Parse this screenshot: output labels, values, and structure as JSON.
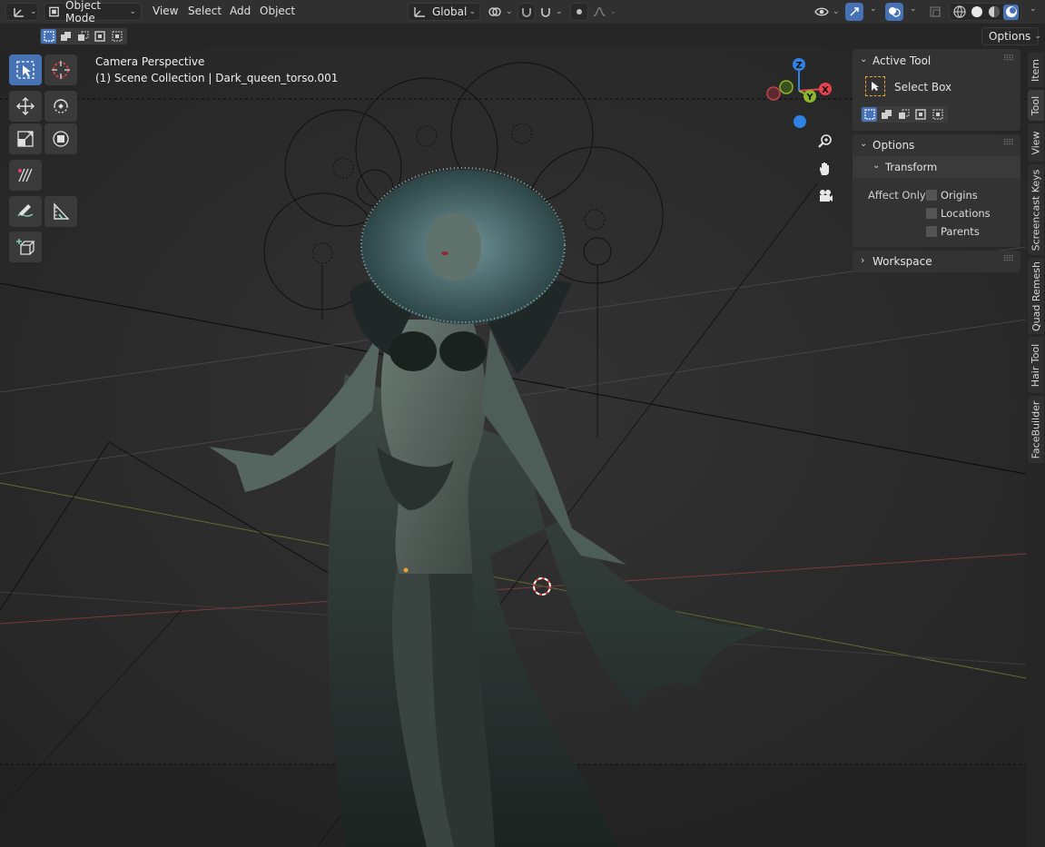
{
  "header": {
    "mode": "Object Mode",
    "menus": [
      "View",
      "Select",
      "Add",
      "Object"
    ],
    "orientation": "Global",
    "options_label": "Options"
  },
  "overlay": {
    "view_name": "Camera Perspective",
    "collection": "(1) Scene Collection | Dark_queen_torso.001"
  },
  "gizmo": {
    "z": "Z",
    "y": "Y",
    "x": "X"
  },
  "npanel": {
    "active_tool": {
      "title": "Active Tool",
      "tool_name": "Select Box"
    },
    "options": {
      "title": "Options",
      "transform": {
        "title": "Transform",
        "affect_only_label": "Affect Only",
        "checkboxes": [
          {
            "label": "Origins",
            "checked": false
          },
          {
            "label": "Locations",
            "checked": false
          },
          {
            "label": "Parents",
            "checked": false
          }
        ]
      }
    },
    "workspace": {
      "title": "Workspace"
    }
  },
  "side_tabs": [
    "Item",
    "Tool",
    "View",
    "Screencast Keys",
    "Quad Remesh",
    "Hair Tool",
    "FaceBuilder"
  ],
  "colors": {
    "accent": "#4772b3",
    "gizmo_x": "#e8424f",
    "gizmo_y": "#8bb72c",
    "gizmo_z": "#2f83e3"
  }
}
